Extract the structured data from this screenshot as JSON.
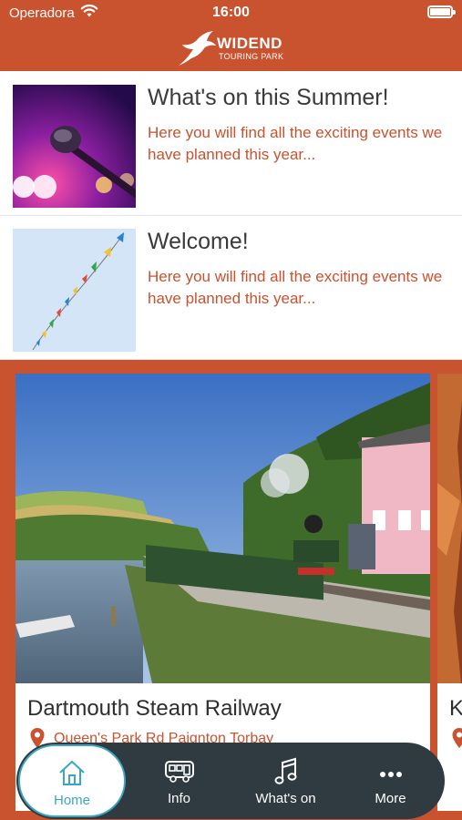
{
  "status_bar": {
    "carrier": "Operadora",
    "time": "16:00"
  },
  "header": {
    "logo_title": "WIDEND",
    "logo_subtitle": "TOURING PARK"
  },
  "news": [
    {
      "title": "What's on this Summer!",
      "text": "Here you will find all the exciting events we have planned this year..."
    },
    {
      "title": "Welcome!",
      "text": "Here you will find all the exciting events we have planned this year..."
    }
  ],
  "attractions": [
    {
      "title": "Dartmouth Steam Railway",
      "address": "Queen's Park Rd Paignton Torbay"
    },
    {
      "title": "Ke",
      "address": ""
    }
  ],
  "tabbar": {
    "tabs": [
      {
        "label": "Home",
        "icon": "home-icon",
        "active": true
      },
      {
        "label": "Info",
        "icon": "caravan-icon",
        "active": false
      },
      {
        "label": "What's on",
        "icon": "music-icon",
        "active": false
      },
      {
        "label": "More",
        "icon": "more-dots-icon",
        "active": false
      }
    ]
  },
  "colors": {
    "brand": "#c9522f",
    "tabbar": "#2f3b40",
    "accent": "#3aa6c4"
  }
}
